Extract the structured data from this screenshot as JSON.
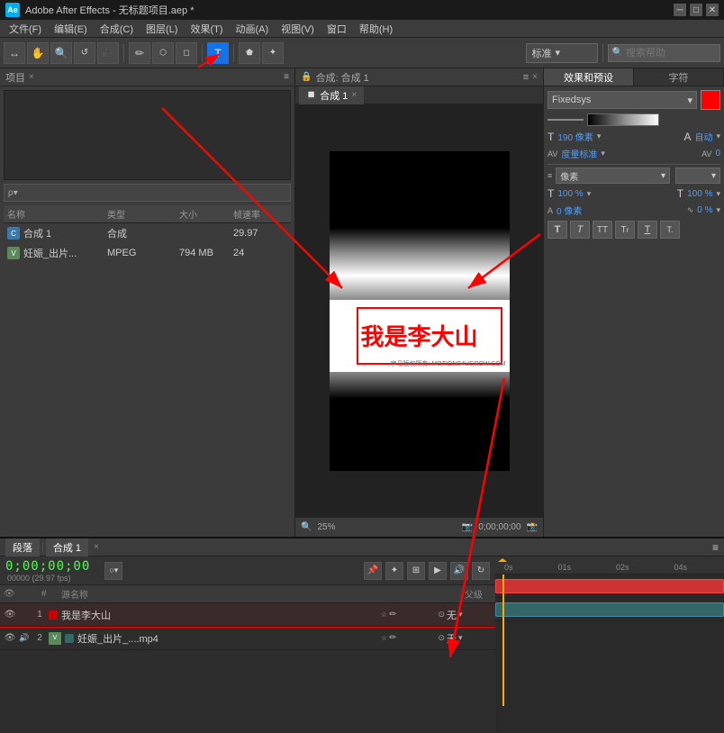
{
  "window": {
    "title": "Adobe After Effects - 无标题项目.aep *",
    "logo_text": "Ae"
  },
  "title_bar": {
    "title": "Adobe After Effects - 无标题项目.aep *",
    "minimize": "─",
    "maximize": "□",
    "close": "✕"
  },
  "menu_bar": {
    "items": [
      "文件(F)",
      "编辑(E)",
      "合成(C)",
      "图层(L)",
      "效果(T)",
      "动画(A)",
      "视图(V)",
      "窗口",
      "帮助(H)"
    ]
  },
  "toolbar": {
    "tools": [
      "↔",
      "🤚",
      "🔍",
      "🔲",
      "⬜",
      "⚙",
      "✏",
      "T",
      "✦",
      "⬡",
      "↗",
      "🎯"
    ],
    "active_tool": "T",
    "preset_dropdown": "标准",
    "search_placeholder": "搜索帮助"
  },
  "left_panel": {
    "title": "项目",
    "close": "×",
    "columns": {
      "name": "名称",
      "type": "类型",
      "size": "大小",
      "fps": "帧速率"
    },
    "items": [
      {
        "name": "合成 1",
        "type": "合成",
        "size": "",
        "fps": "29.97",
        "icon": "comp"
      },
      {
        "name": "妊娠_出片...",
        "type": "MPEG",
        "size": "794 MB",
        "fps": "24",
        "icon": "video"
      }
    ]
  },
  "composition": {
    "title": "合成: 合成 1",
    "tab_label": "合成 1",
    "canvas_text": "我是李大山",
    "watermark": "字母版权所有: MOTIONB4UGROW.COM",
    "zoom": "25%",
    "time": "0;00;00;00"
  },
  "right_panel": {
    "tabs": [
      "效果和预设",
      "字符"
    ],
    "font": "Fixedsys",
    "size": "190 像素",
    "size_auto": "自动",
    "tracking_label": "度量标准",
    "tracking_value": "0",
    "kerning_label": "AV",
    "kerning_value": "0",
    "pixels_label": "像素",
    "t_size_pct": "100 %",
    "t_size_pct2": "100 %",
    "t_offset": "0 像素",
    "t_offset2": "0 %",
    "format_buttons": [
      "T",
      "T",
      "TT",
      "Tr",
      "T",
      "T."
    ]
  },
  "timeline": {
    "title": "段落",
    "comp_tab": "合成 1",
    "time_display": "0;00;00;00",
    "fps_display": "00000 (29.97 fps)",
    "columns": {
      "eye": "",
      "audio": "",
      "num": "#",
      "name": "源名称",
      "shy": "",
      "solo": "",
      "lock": "",
      "effects": "",
      "motion": "",
      "blend": "",
      "parent": "父级"
    },
    "ruler_marks": [
      "01s",
      "02s",
      "04s"
    ],
    "layers": [
      {
        "num": "1",
        "name": "我是李大山",
        "type": "text",
        "color": "#cc0000",
        "parent": "无",
        "eye_visible": true,
        "audio": false
      },
      {
        "num": "2",
        "name": "妊娠_出片_....mp4",
        "type": "video",
        "color": "#336666",
        "parent": "无",
        "eye_visible": true,
        "audio": true
      }
    ]
  }
}
